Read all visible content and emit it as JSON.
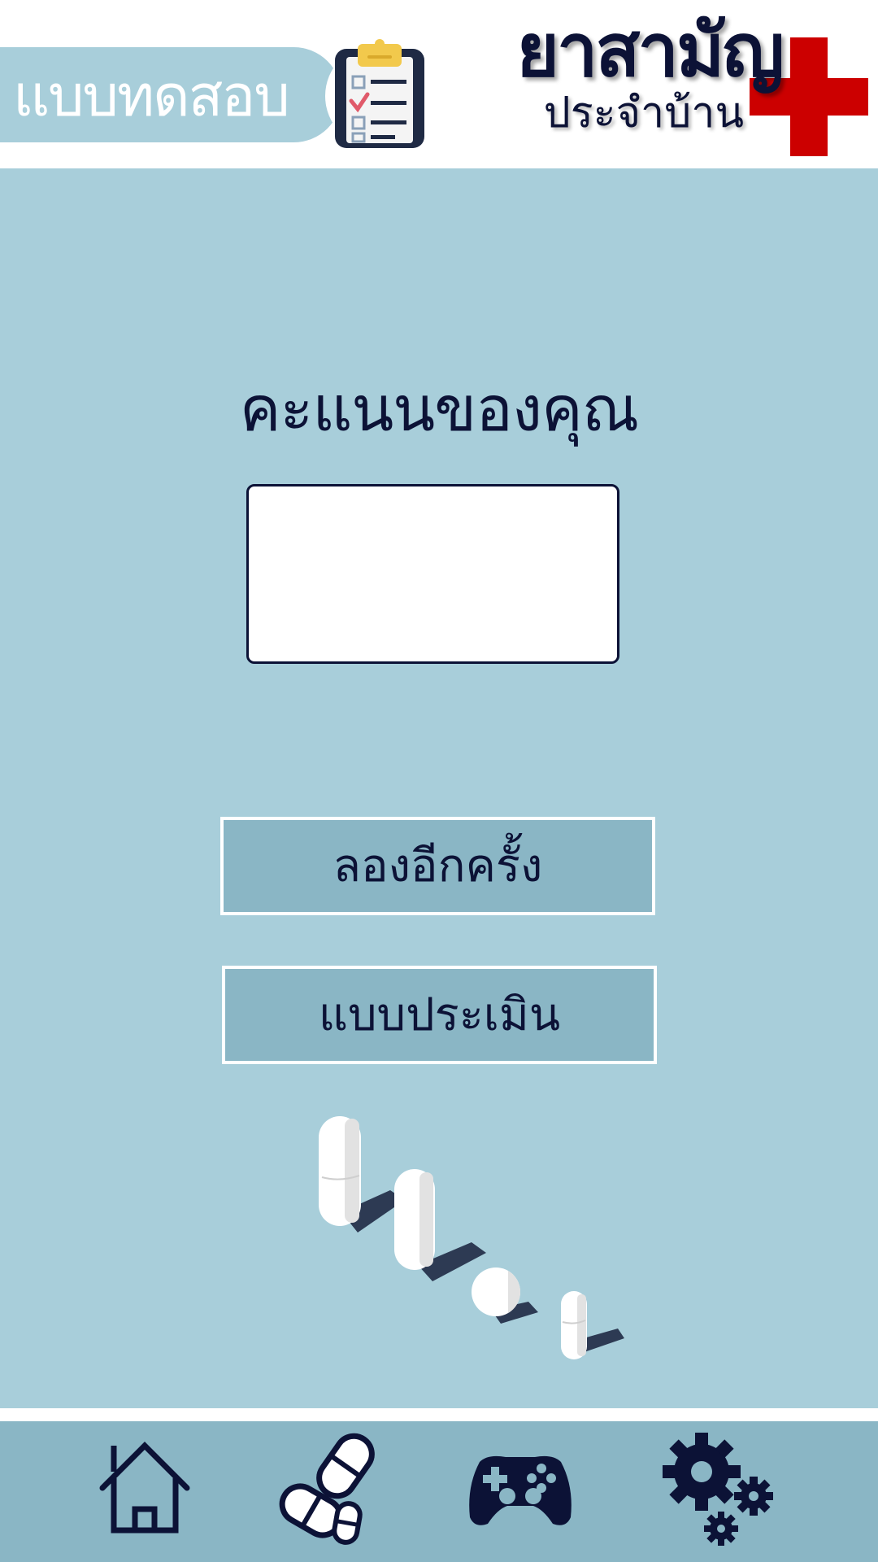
{
  "header": {
    "page_title": "แบบทดสอบ",
    "brand_main": "ยาสามัญ",
    "brand_sub": "ประจำบ้าน"
  },
  "score": {
    "heading": "คะแนนของคุณ",
    "value": ""
  },
  "buttons": {
    "retry_label": "ลองอีกครั้ง",
    "assessment_label": "แบบประเมิน"
  },
  "nav": {
    "items": [
      {
        "icon": "home-icon"
      },
      {
        "icon": "pills-icon"
      },
      {
        "icon": "gamepad-icon"
      },
      {
        "icon": "settings-gears-icon"
      }
    ]
  },
  "colors": {
    "background": "#a8ceda",
    "navbar": "#8ab6c5",
    "text_dark": "#0c1236",
    "brand_red": "#cc0000",
    "button_fill": "#8ab6c5"
  }
}
